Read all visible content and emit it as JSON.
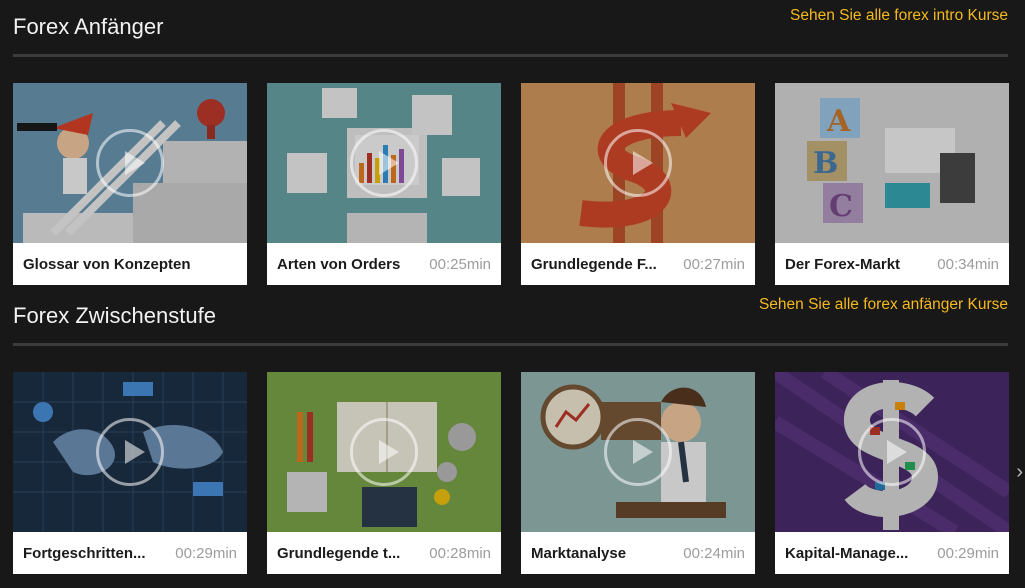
{
  "sections": [
    {
      "title": "Forex Anfänger",
      "link": "Sehen Sie alle forex intro Kurse",
      "cards": [
        {
          "title": "Glossar von Konzepten",
          "duration": ""
        },
        {
          "title": "Arten von Orders",
          "duration": "00:25min"
        },
        {
          "title": "Grundlegende F...",
          "duration": "00:27min"
        },
        {
          "title": "Der Forex-Markt",
          "duration": "00:34min"
        }
      ]
    },
    {
      "title": "Forex Zwischenstufe",
      "link": "Sehen Sie alle forex anfänger Kurse",
      "cards": [
        {
          "title": "Fortgeschritten...",
          "duration": "00:29min"
        },
        {
          "title": "Grundlegende t...",
          "duration": "00:28min"
        },
        {
          "title": "Marktanalyse",
          "duration": "00:24min"
        },
        {
          "title": "Kapital-Manage...",
          "duration": "00:29min"
        }
      ]
    }
  ],
  "carousel_next": "›",
  "colors": {
    "background": "#181818",
    "link": "#f5b91e",
    "duration": "#9c9c9c"
  },
  "icons": [
    "play-icon",
    "chevron-right-icon"
  ]
}
